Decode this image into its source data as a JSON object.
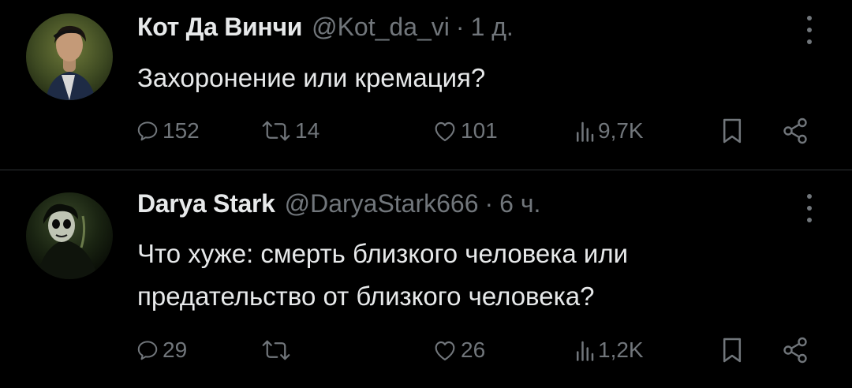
{
  "tweets": [
    {
      "author_name": "Кот Да Винчи",
      "handle": "@Kot_da_vi",
      "separator": "·",
      "time": "1 д.",
      "text": "Захоронение или кремация?",
      "stats": {
        "replies": "152",
        "retweets": "14",
        "likes": "101",
        "views": "9,7K"
      }
    },
    {
      "author_name": "Darya Stark",
      "handle": "@DaryaStark666",
      "separator": "·",
      "time": "6 ч.",
      "text": "Что хуже: смерть близкого человека или предательство от близкого человека?",
      "stats": {
        "replies": "29",
        "retweets": "",
        "likes": "26",
        "views": "1,2K"
      }
    }
  ],
  "icons": [
    "avatar",
    "more-dots-icon",
    "reply-icon",
    "retweet-icon",
    "like-icon",
    "views-icon",
    "bookmark-icon",
    "share-icon"
  ],
  "colors": {
    "background": "#000000",
    "text": "#e7e9ea",
    "muted": "#71767b",
    "divider": "#2f3336"
  }
}
